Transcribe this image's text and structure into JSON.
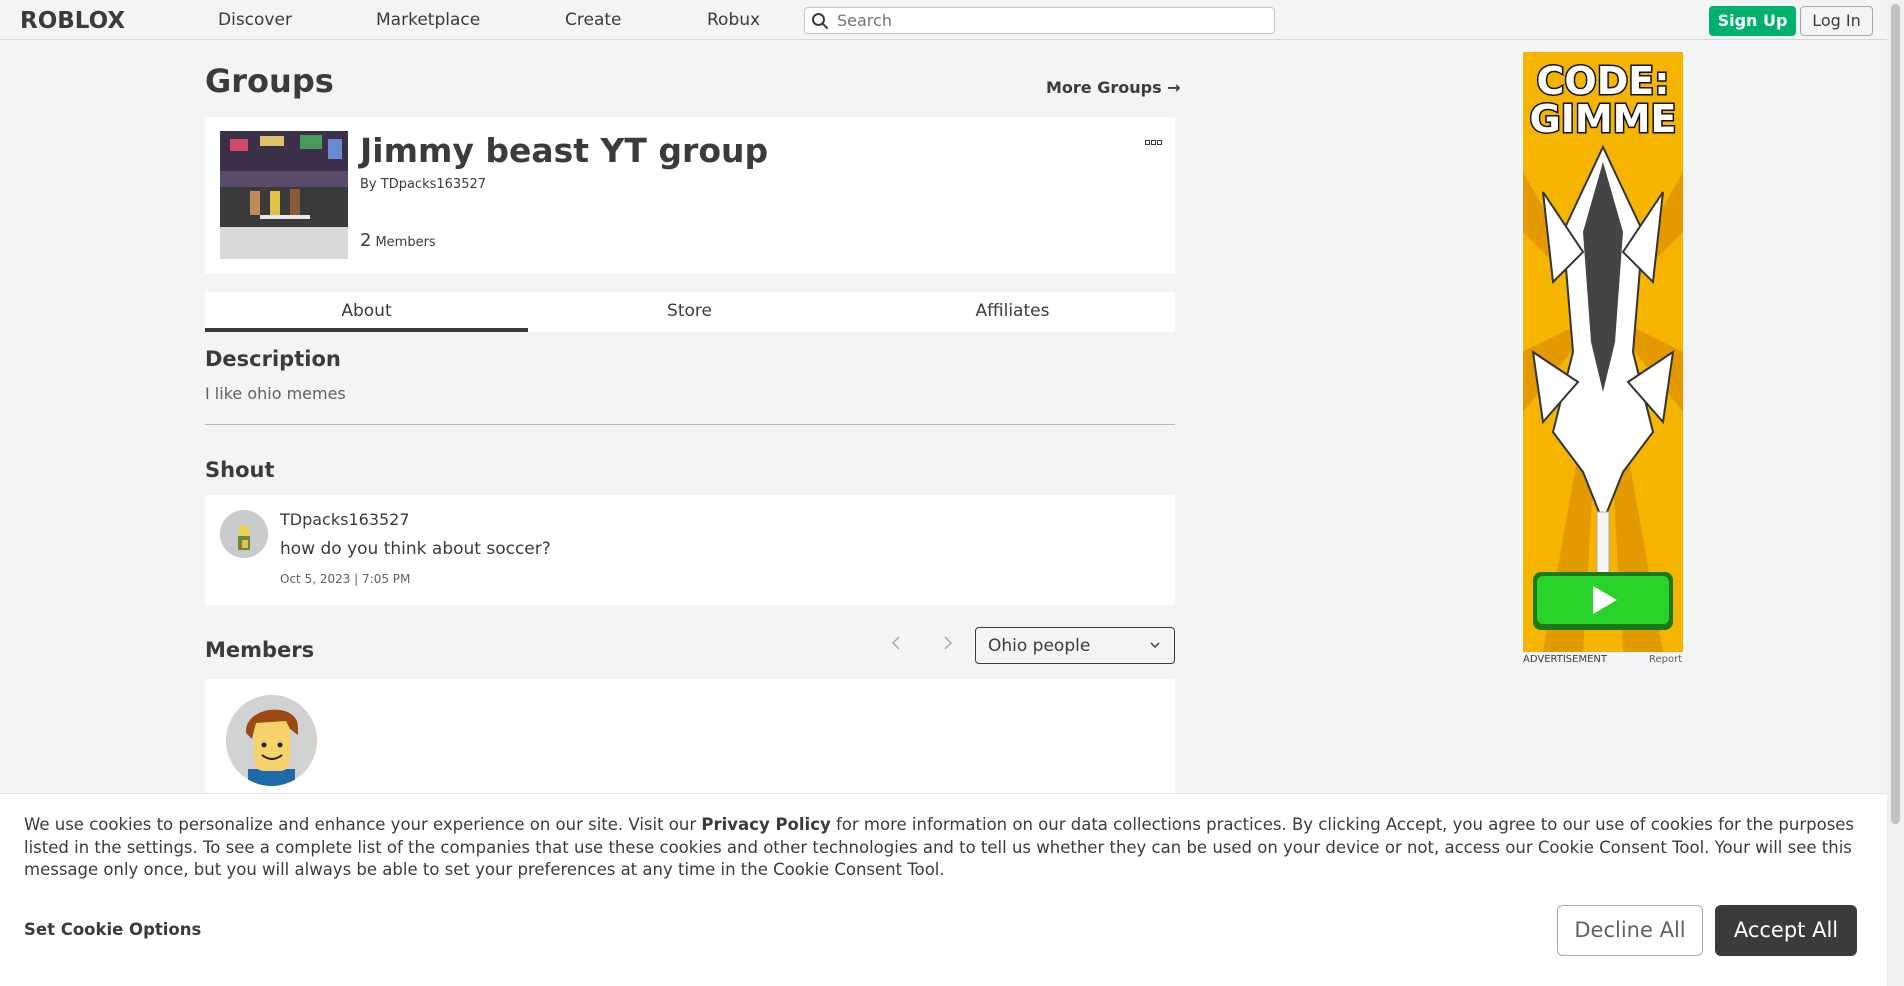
{
  "nav": {
    "logo": "ROBLOX",
    "links": [
      "Discover",
      "Marketplace",
      "Create",
      "Robux"
    ],
    "search_placeholder": "Search",
    "signup_label": "Sign Up",
    "login_label": "Log In"
  },
  "page": {
    "title": "Groups",
    "more_groups": "More Groups →"
  },
  "group": {
    "name": "Jimmy beast YT group",
    "by_prefix": "By",
    "owner": "TDpacks163527",
    "member_count": "2",
    "member_label": "Members",
    "more_icon": "more-dots-icon"
  },
  "tabs": [
    "About",
    "Store",
    "Affiliates"
  ],
  "about": {
    "description_heading": "Description",
    "description": "I like ohio memes",
    "shout_heading": "Shout",
    "shout": {
      "user": "TDpacks163527",
      "message": "how do you think about soccer?",
      "date": "Oct 5, 2023 | 7:05 PM"
    },
    "members_heading": "Members",
    "role_selected": "Ohio people"
  },
  "ad": {
    "headline_1": "CODE:",
    "headline_2": "GIMME",
    "label": "ADVERTISEMENT",
    "report": "Report"
  },
  "cookie": {
    "text_before": "We use cookies to personalize and enhance your experience on our site. Visit our ",
    "privacy_link": "Privacy Policy",
    "text_after": " for more information on our data collections practices. By clicking Accept, you agree to our use of cookies for the purposes listed in the settings. To see a complete list of the companies that use these cookies and other technologies and to tell us whether they can be used on your device or not, access our Cookie Consent Tool. Your will see this message only once, but you will always be able to set your preferences at any time in the Cookie Consent Tool.",
    "options_label": "Set Cookie Options",
    "decline_label": "Decline All",
    "accept_label": "Accept All"
  },
  "colors": {
    "accent_green": "#00b06f",
    "text_dark": "#393b3d",
    "background": "#f2f4f5"
  }
}
